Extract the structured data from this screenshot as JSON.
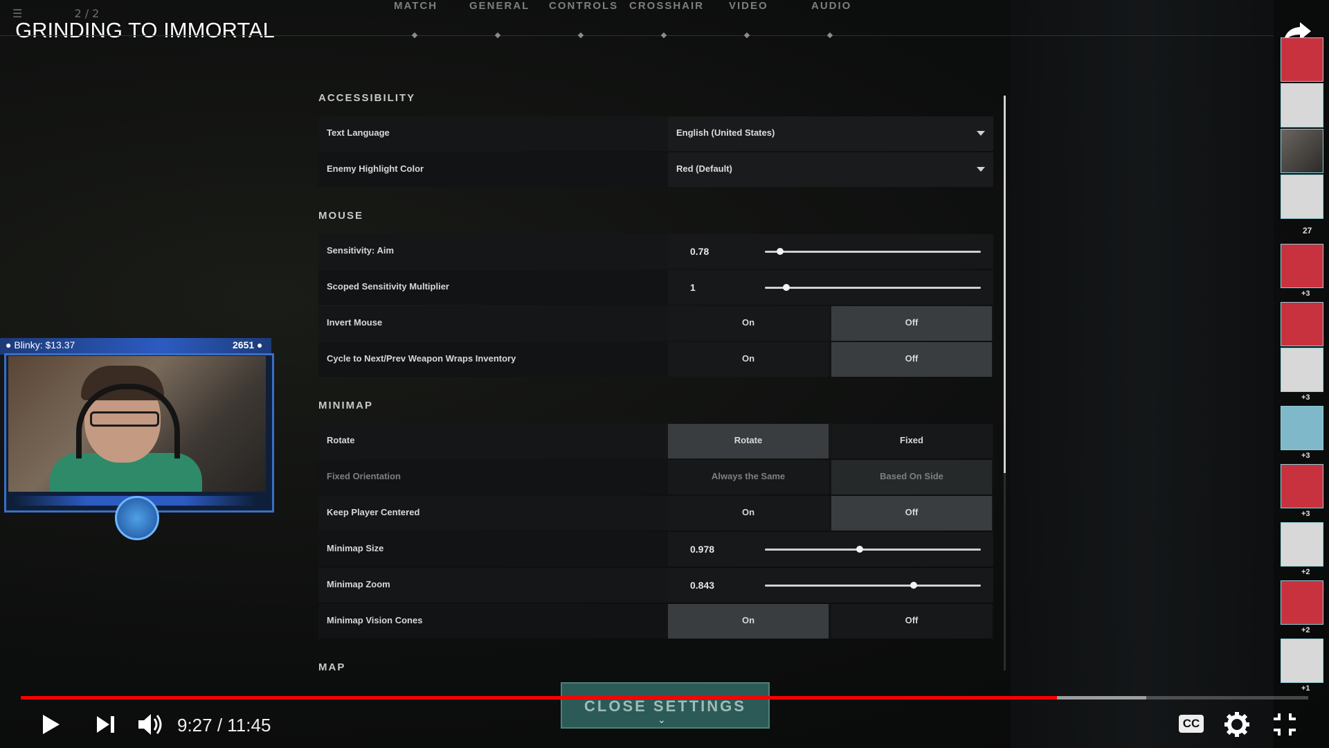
{
  "video": {
    "title": "GRINDING TO IMMORTAL",
    "current_time": "9:27",
    "duration": "11:45",
    "time_display": "9:27 / 11:45",
    "progress_fraction": 0.805,
    "buffer_fraction": 0.874,
    "cc_label": "CC"
  },
  "game": {
    "top_counter": "2 / 2",
    "nav_tabs": [
      "MATCH",
      "GENERAL",
      "CONTROLS",
      "CROSSHAIR",
      "VIDEO",
      "AUDIO"
    ],
    "sections": {
      "accessibility": "ACCESSIBILITY",
      "mouse": "MOUSE",
      "minimap": "MINIMAP",
      "map": "MAP"
    },
    "settings": {
      "text_language": {
        "label": "Text Language",
        "value": "English (United States)"
      },
      "enemy_highlight": {
        "label": "Enemy Highlight Color",
        "value": "Red (Default)"
      },
      "sensitivity_aim": {
        "label": "Sensitivity: Aim",
        "value": "0.78",
        "level": 0.07
      },
      "scoped_sensitivity": {
        "label": "Scoped Sensitivity Multiplier",
        "value": "1",
        "level": 0.1
      },
      "invert_mouse": {
        "label": "Invert Mouse",
        "on": "On",
        "off": "Off",
        "selected": "Off"
      },
      "cycle_wraps": {
        "label": "Cycle to Next/Prev Weapon Wraps Inventory",
        "on": "On",
        "off": "Off",
        "selected": "Off"
      },
      "rotate": {
        "label": "Rotate",
        "option_a": "Rotate",
        "option_b": "Fixed",
        "selected": "Rotate"
      },
      "fixed_orientation": {
        "label": "Fixed Orientation",
        "option_a": "Always the Same",
        "option_b": "Based On Side",
        "selected": "Based On Side"
      },
      "keep_centered": {
        "label": "Keep Player Centered",
        "on": "On",
        "off": "Off",
        "selected": "Off"
      },
      "minimap_size": {
        "label": "Minimap Size",
        "value": "0.978",
        "level": 0.44
      },
      "minimap_zoom": {
        "label": "Minimap Zoom",
        "value": "0.843",
        "level": 0.69
      },
      "vision_cones": {
        "label": "Minimap Vision Cones",
        "on": "On",
        "off": "Off",
        "selected": "On"
      }
    },
    "close_button": "CLOSE SETTINGS"
  },
  "webcam": {
    "donor": "Blinky: $13.37",
    "bits": "2651"
  },
  "sidebar": {
    "kill_count": "27",
    "card_counts": [
      "+3",
      "+3",
      "+3",
      "+3",
      "+2",
      "+2",
      "+1"
    ]
  },
  "colors": {
    "progress_red": "#ff0000",
    "accent_teal": "#2e5f5a",
    "webcam_blue": "#2c5bc1",
    "card_red": "#c8323f"
  }
}
